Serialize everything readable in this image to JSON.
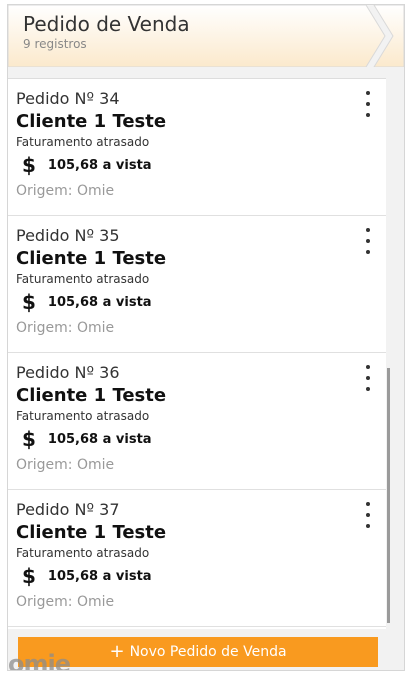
{
  "header": {
    "title": "Pedido de Venda",
    "subtitle": "9 registros"
  },
  "orders": [
    {
      "number": "Pedido Nº 34",
      "client": "Cliente 1 Teste",
      "status": "Faturamento atrasado",
      "currency_symbol": "$",
      "amount": "105,68 a vista",
      "origin": "Origem: Omie"
    },
    {
      "number": "Pedido Nº 35",
      "client": "Cliente 1 Teste",
      "status": "Faturamento atrasado",
      "currency_symbol": "$",
      "amount": "105,68 a vista",
      "origin": "Origem: Omie"
    },
    {
      "number": "Pedido Nº 36",
      "client": "Cliente 1 Teste",
      "status": "Faturamento atrasado",
      "currency_symbol": "$",
      "amount": "105,68 a vista",
      "origin": "Origem: Omie"
    },
    {
      "number": "Pedido Nº 37",
      "client": "Cliente 1 Teste",
      "status": "Faturamento atrasado",
      "currency_symbol": "$",
      "amount": "105,68 a vista",
      "origin": "Origem: Omie"
    }
  ],
  "new_order_button": {
    "icon": "plus-icon",
    "label": "Novo Pedido de Venda"
  },
  "logo": {
    "text": "omie"
  },
  "colors": {
    "accent": "#f99a1f",
    "header_bg_start": "#ffffff",
    "header_bg_end": "#fbe9cc"
  }
}
